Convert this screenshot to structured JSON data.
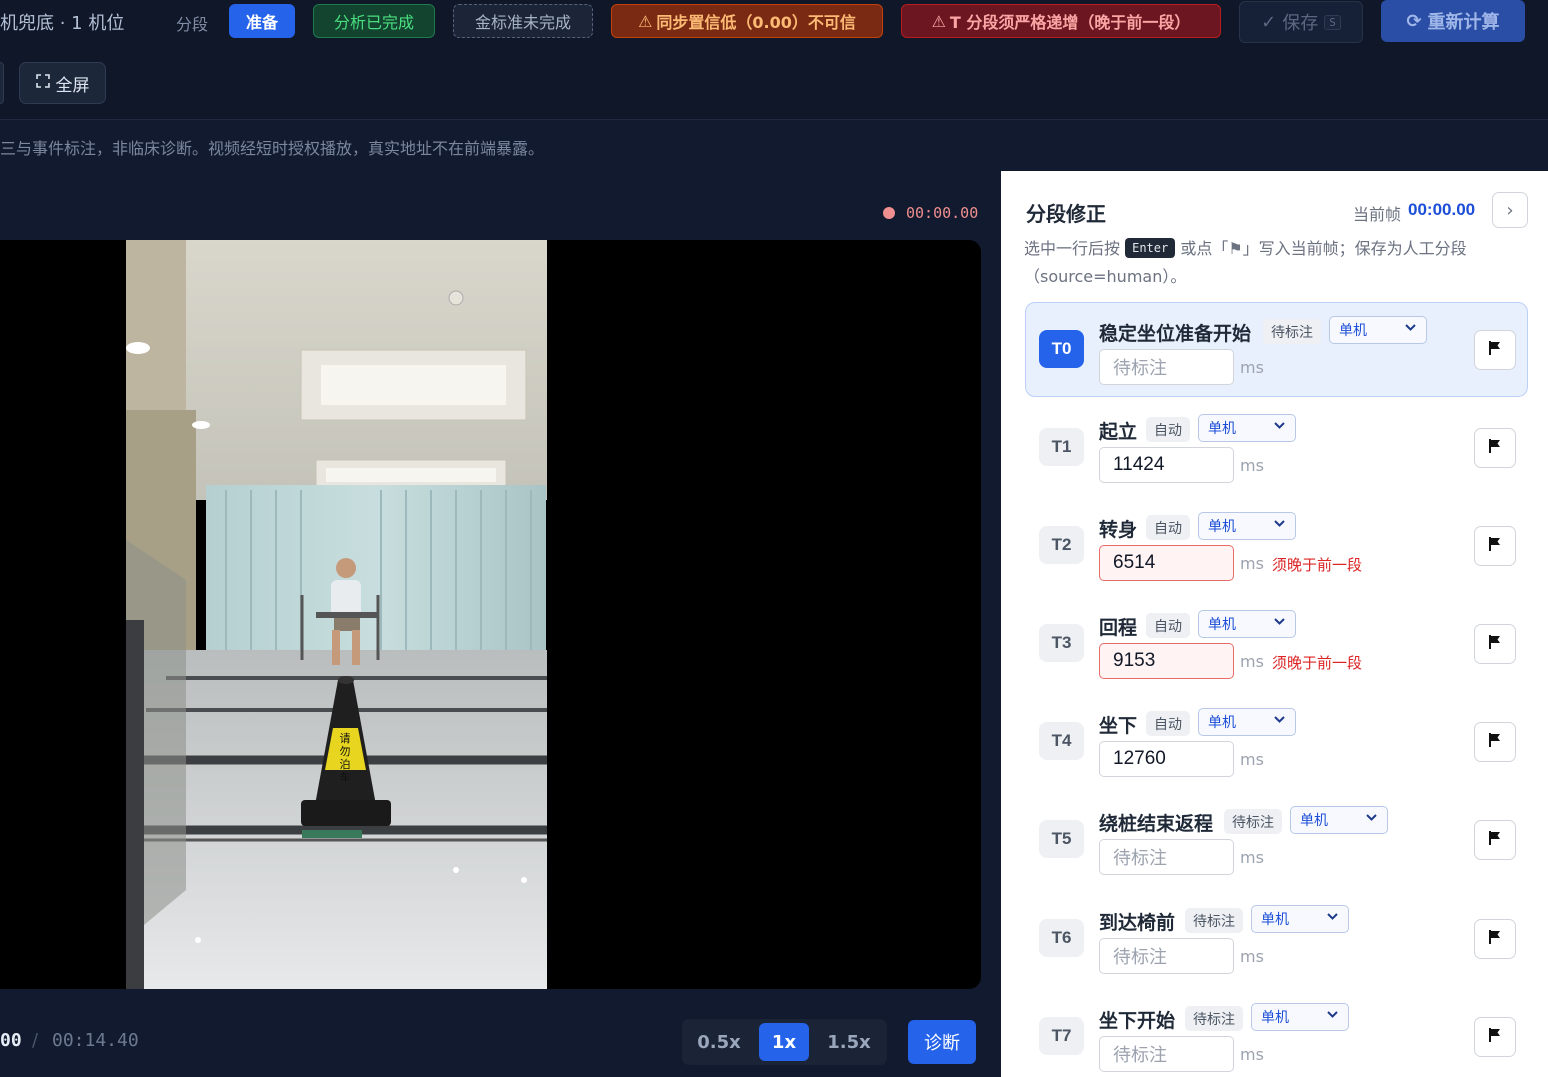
{
  "header": {
    "title": "机兜底 · 1 机位",
    "segment_label": "分段",
    "status_ready": "准备",
    "analysis_done": "分析已完成",
    "gold_incomplete": "金标准未完成",
    "warning_sync": "同步置信低（0.00）不可信",
    "warning_order": "T 分段须严格递增（晚于前一段）",
    "save_label": "保存",
    "save_shortcut": "S",
    "recalc_label": "重新计算",
    "fullscreen_label": "全屏"
  },
  "disclaimer": "三与事件标注，非临床诊断。视频经短时授权播放，真实地址不在前端暴露。",
  "video": {
    "record_time": "00:00.00",
    "current_time": "00",
    "separator": "/",
    "total_time": "00:14.40",
    "cone_text": "请勿泊车"
  },
  "speeds": [
    {
      "label": "0.5x",
      "active": false
    },
    {
      "label": "1x",
      "active": true
    },
    {
      "label": "1.5x",
      "active": false
    }
  ],
  "diagnose_label": "诊断",
  "panel": {
    "title": "分段修正",
    "current_frame_label": "当前帧",
    "current_frame_value": "00:00.00",
    "hint_pre": "选中一行后按",
    "hint_key": "Enter",
    "hint_post": "或点「⚑」写入当前帧；保存为人工分段（source=human）。",
    "unit": "ms"
  },
  "segments": [
    {
      "id": "T0",
      "name": "稳定坐位准备开始",
      "status": "待标注",
      "camera": "单机",
      "value": "",
      "placeholder": "待标注",
      "error": "",
      "active": true
    },
    {
      "id": "T1",
      "name": "起立",
      "status": "自动",
      "camera": "单机",
      "value": "11424",
      "placeholder": "",
      "error": "",
      "active": false
    },
    {
      "id": "T2",
      "name": "转身",
      "status": "自动",
      "camera": "单机",
      "value": "6514",
      "placeholder": "",
      "error": "须晚于前一段",
      "active": false
    },
    {
      "id": "T3",
      "name": "回程",
      "status": "自动",
      "camera": "单机",
      "value": "9153",
      "placeholder": "",
      "error": "须晚于前一段",
      "active": false
    },
    {
      "id": "T4",
      "name": "坐下",
      "status": "自动",
      "camera": "单机",
      "value": "12760",
      "placeholder": "",
      "error": "",
      "active": false
    },
    {
      "id": "T5",
      "name": "绕桩结束返程",
      "status": "待标注",
      "camera": "单机",
      "value": "",
      "placeholder": "待标注",
      "error": "",
      "active": false
    },
    {
      "id": "T6",
      "name": "到达椅前",
      "status": "待标注",
      "camera": "单机",
      "value": "",
      "placeholder": "待标注",
      "error": "",
      "active": false
    },
    {
      "id": "T7",
      "name": "坐下开始",
      "status": "待标注",
      "camera": "单机",
      "value": "",
      "placeholder": "待标注",
      "error": "",
      "active": false
    }
  ],
  "colors": {
    "accent": "#2563eb",
    "success": "#4ade80",
    "warning": "#fdba74",
    "danger": "#dc2626",
    "record": "#f08f8f"
  }
}
